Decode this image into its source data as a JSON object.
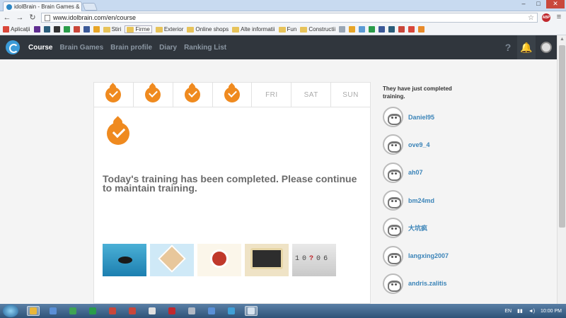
{
  "browser": {
    "tab_title": "idolBrain - Brain Games &",
    "tab_close": "×",
    "url": "www.idolbrain.com/en/course",
    "window_controls": [
      "–",
      "□",
      "✕"
    ],
    "adblock": "ABP",
    "bookmarks": [
      {
        "label": "Aplicații",
        "icon": "apps-icon",
        "color": "#d9473a"
      },
      {
        "label": "",
        "icon": "yahoo-icon",
        "color": "#5f2d91"
      },
      {
        "label": "",
        "icon": "tile-icon",
        "color": "#2b5d7a"
      },
      {
        "label": "",
        "icon": "tile-icon",
        "color": "#333333"
      },
      {
        "label": "",
        "icon": "tile-icon",
        "color": "#2a9c4a"
      },
      {
        "label": "",
        "icon": "tile-icon",
        "color": "#c9463a"
      },
      {
        "label": "",
        "icon": "tile-icon",
        "color": "#3b5998"
      },
      {
        "label": "",
        "icon": "tile-icon",
        "color": "#e7a527"
      },
      {
        "label": "Stiri",
        "icon": "folder-icon"
      },
      {
        "label": "Firme",
        "icon": "folder-icon"
      },
      {
        "label": "Exterior",
        "icon": "folder-icon"
      },
      {
        "label": "Online shops",
        "icon": "folder-icon"
      },
      {
        "label": "Alte informatii",
        "icon": "folder-icon"
      },
      {
        "label": "Fun",
        "icon": "folder-icon"
      },
      {
        "label": "Constructii",
        "icon": "folder-icon"
      }
    ],
    "bookmark_icons": [
      "#9aa7b5",
      "#e7a527",
      "#5b9bd5",
      "#2a9c4a",
      "#3b5998",
      "#2b5d7a",
      "#c9463a",
      "#d9473a",
      "#e88a2a"
    ]
  },
  "site": {
    "nav": [
      {
        "label": "Course",
        "active": true
      },
      {
        "label": "Brain Games"
      },
      {
        "label": "Brain profile"
      },
      {
        "label": "Diary"
      },
      {
        "label": "Ranking List"
      }
    ],
    "help_glyph": "?"
  },
  "training": {
    "days": [
      {
        "label": "",
        "completed": true
      },
      {
        "label": "",
        "completed": true
      },
      {
        "label": "",
        "completed": true
      },
      {
        "label": "",
        "completed": true
      },
      {
        "label": "FRI",
        "completed": false
      },
      {
        "label": "SAT",
        "completed": false
      },
      {
        "label": "SUN",
        "completed": false
      }
    ],
    "message": "Today's training has been completed. Please continue to maintain training.",
    "games": [
      {
        "icon": "fish-game-icon"
      },
      {
        "icon": "board-game-icon"
      },
      {
        "icon": "medal-game-icon"
      },
      {
        "icon": "screen-game-icon"
      },
      {
        "icon": "number-game-icon",
        "digits": [
          "1",
          "0",
          "?",
          "0",
          "6"
        ]
      }
    ]
  },
  "sidebar": {
    "title": "They have just completed training.",
    "users": [
      "Daniel95",
      "ove9_4",
      "ah07",
      "bm24md",
      "大坑疯",
      "langxing2007",
      "andris.zalitis"
    ]
  },
  "taskbar": {
    "language": "EN",
    "time": "10:00 PM",
    "items": [
      {
        "icon": "chrome-icon",
        "active": true
      },
      {
        "icon": "app-icon"
      },
      {
        "icon": "app-icon"
      },
      {
        "icon": "app-icon"
      },
      {
        "icon": "app-icon"
      },
      {
        "icon": "app-icon"
      },
      {
        "icon": "app-icon"
      },
      {
        "icon": "pdf-icon"
      },
      {
        "icon": "app-icon"
      },
      {
        "icon": "app-icon"
      },
      {
        "icon": "app-icon"
      },
      {
        "icon": "app-icon",
        "active": true
      }
    ]
  }
}
